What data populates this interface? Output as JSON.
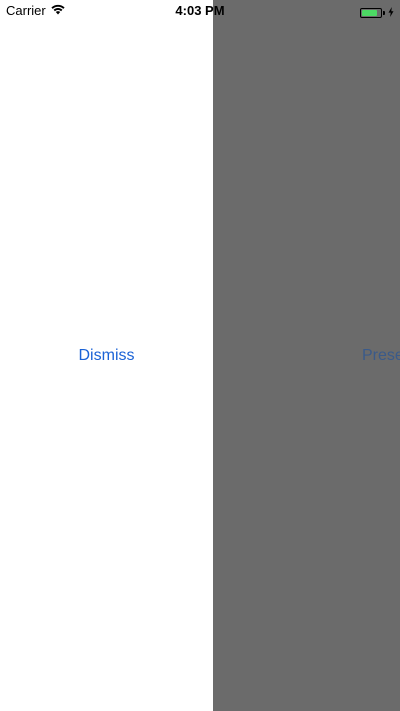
{
  "status_bar": {
    "carrier": "Carrier",
    "time": "4:03 PM",
    "battery_level": 0.85,
    "battery_color": "#4cd964",
    "icons": [
      "wifi-icon",
      "battery-icon",
      "charging-bolt-icon"
    ]
  },
  "presented_view": {
    "dismiss_label": "Dismiss",
    "background": "#ffffff"
  },
  "presenting_view": {
    "present_label": "Prese",
    "dim_color": "#6b6b6b"
  },
  "colors": {
    "tint": "#1a62d6"
  }
}
